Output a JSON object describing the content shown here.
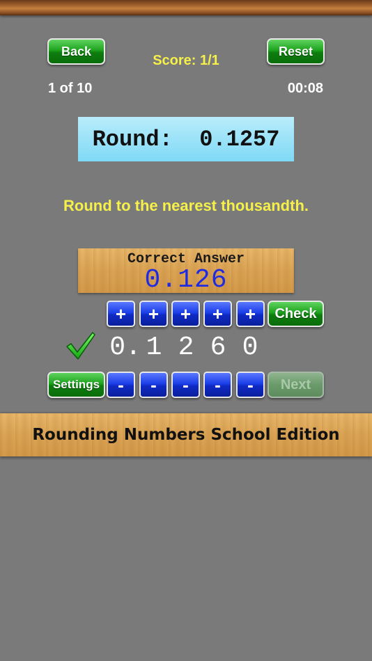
{
  "header": {
    "back_label": "Back",
    "reset_label": "Reset",
    "score": "Score: 1/1",
    "counter": "1 of 10",
    "timer": "00:08"
  },
  "problem": {
    "text": "Round:  0.1257",
    "instruction": "Round to the nearest thousandth."
  },
  "answer": {
    "title": "Correct Answer",
    "value": "0.126"
  },
  "controls": {
    "plus": [
      "+",
      "+",
      "+",
      "+",
      "+"
    ],
    "minus": [
      "-",
      "-",
      "-",
      "-",
      "-"
    ],
    "check_label": "Check",
    "settings_label": "Settings",
    "next_label": "Next",
    "digits": [
      "0.",
      "1",
      "2",
      "6",
      "0"
    ],
    "status_icon": "checkmark-icon"
  },
  "footer": {
    "title": "Rounding Numbers School Edition"
  },
  "colors": {
    "background": "#7a7a7a",
    "accent_yellow": "#f6f04a",
    "answer_blue": "#1f2be0",
    "button_green": "#1ea31e",
    "button_blue": "#1c3fe8"
  }
}
